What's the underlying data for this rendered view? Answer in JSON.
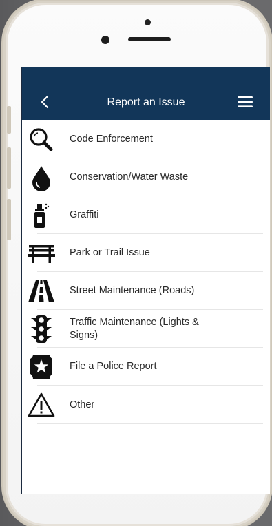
{
  "header": {
    "title": "Report an Issue",
    "back_icon": "chevron-left-icon",
    "menu_icon": "hamburger-menu-icon",
    "background": "#123659"
  },
  "items": [
    {
      "label": "Code Enforcement",
      "icon": "magnifier-icon"
    },
    {
      "label": "Conservation/Water Waste",
      "icon": "water-drop-icon"
    },
    {
      "label": "Graffiti",
      "icon": "spray-can-icon"
    },
    {
      "label": "Park or Trail Issue",
      "icon": "bench-icon"
    },
    {
      "label": "Street Maintenance (Roads)",
      "icon": "road-icon"
    },
    {
      "label": "Traffic Maintenance (Lights & Signs)",
      "icon": "traffic-light-icon"
    },
    {
      "label": "File a Police Report",
      "icon": "police-badge-icon"
    },
    {
      "label": "Other",
      "icon": "warning-triangle-icon"
    }
  ]
}
